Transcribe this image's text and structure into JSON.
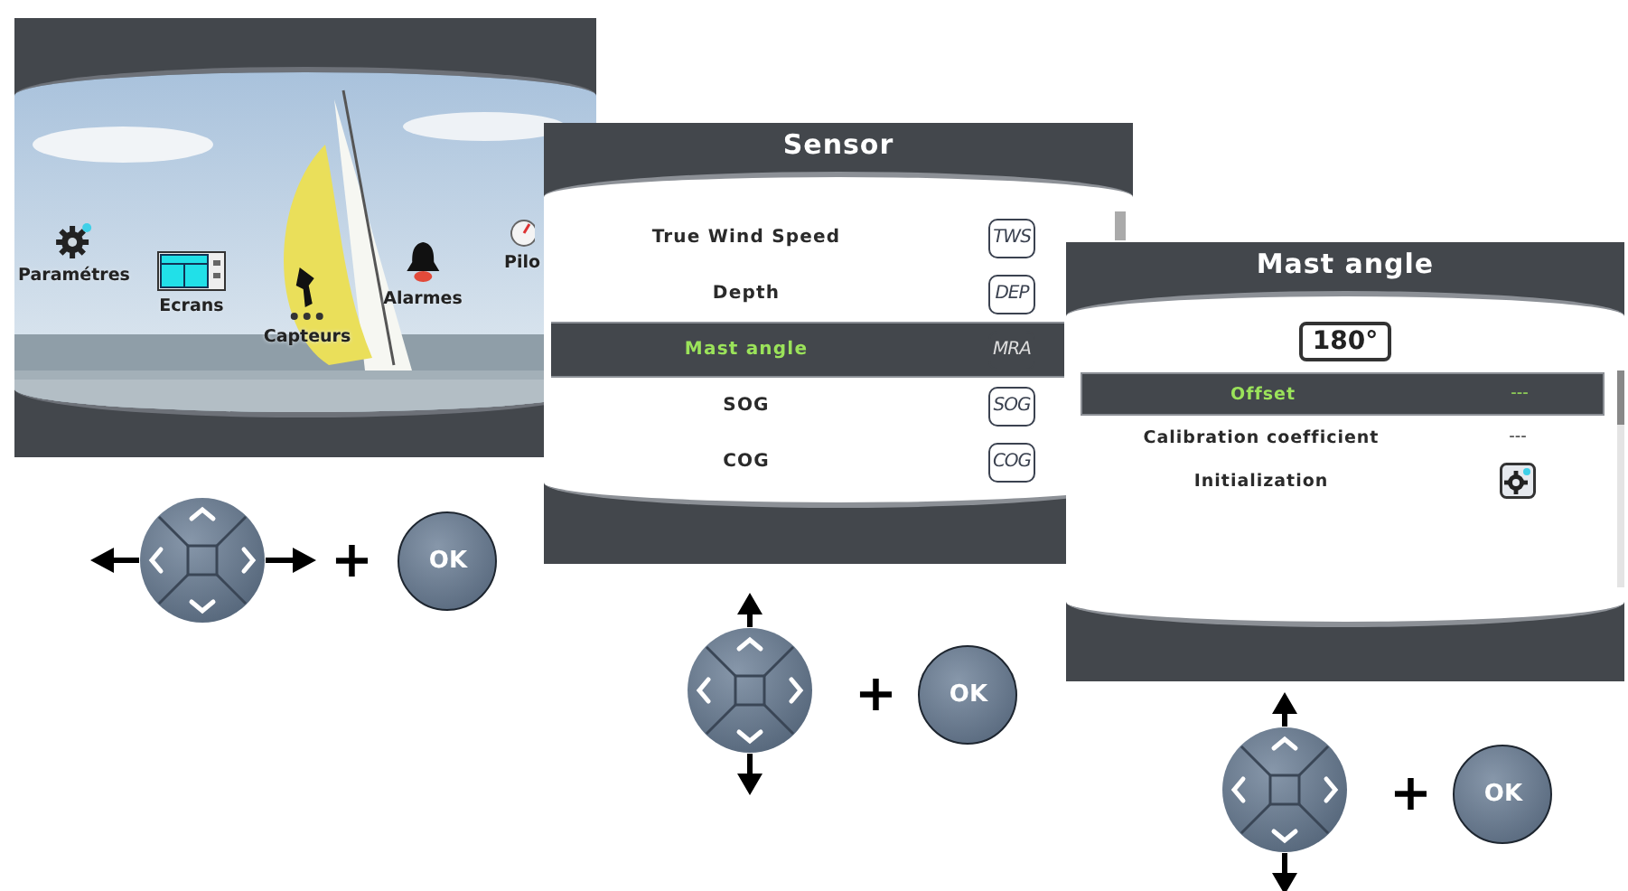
{
  "home_screen": {
    "items": [
      {
        "kind": "gear",
        "label": "Paramétres"
      },
      {
        "kind": "screens",
        "label": "Ecrans"
      },
      {
        "kind": "sensors",
        "label": "Capteurs"
      },
      {
        "kind": "bell",
        "label": "Alarmes"
      },
      {
        "kind": "gauge",
        "label": "Pilo"
      }
    ]
  },
  "sensor_screen": {
    "title": "Sensor",
    "rows": [
      {
        "label": "True Wind Speed",
        "badge": "TWS",
        "selected": false
      },
      {
        "label": "Depth",
        "badge": "DEP",
        "selected": false
      },
      {
        "label": "Mast angle",
        "badge": "MRA",
        "selected": true
      },
      {
        "label": "SOG",
        "badge": "SOG",
        "selected": false
      },
      {
        "label": "COG",
        "badge": "COG",
        "selected": false
      }
    ]
  },
  "mast_angle_screen": {
    "title": "Mast angle",
    "reading": "180°",
    "rows": [
      {
        "kind": "value",
        "label": "Offset",
        "value": "---",
        "selected": true
      },
      {
        "kind": "value",
        "label": "Calibration coefficient",
        "value": "---",
        "selected": false
      },
      {
        "kind": "action",
        "label": "Initialization",
        "selected": false
      }
    ]
  },
  "steps": [
    {
      "kind": "horizontal",
      "plus": "+",
      "button": "OK"
    },
    {
      "kind": "vertical",
      "plus": "+",
      "button": "OK"
    },
    {
      "kind": "vertical",
      "plus": "+",
      "button": "OK"
    }
  ]
}
